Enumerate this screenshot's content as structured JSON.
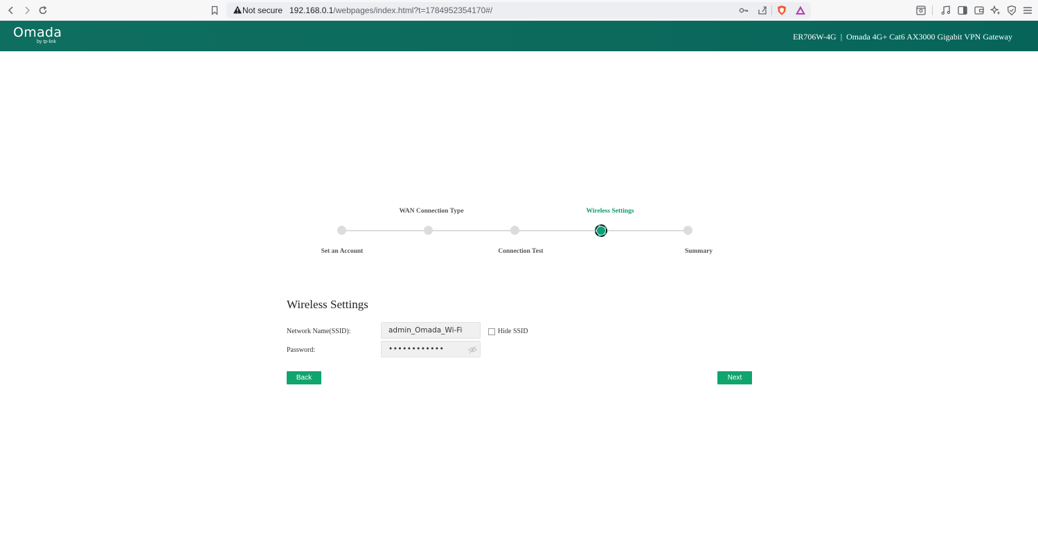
{
  "browser": {
    "not_secure_label": "Not secure",
    "url_host": "192.168.0.1",
    "url_path": "/webpages/index.html?t=1784952354170#/"
  },
  "header": {
    "logo_main": "Omada",
    "logo_sub": "by tp-link",
    "device_model": "ER706W-4G",
    "separator": "|",
    "device_name": "Omada 4G+ Cat6 AX3000 Gigabit VPN Gateway"
  },
  "stepper": {
    "steps": [
      {
        "label": "Set an Account",
        "position": "bottom"
      },
      {
        "label": "WAN Connection Type",
        "position": "top"
      },
      {
        "label": "Connection Test",
        "position": "bottom"
      },
      {
        "label": "Wireless Settings",
        "position": "top"
      },
      {
        "label": "Summary",
        "position": "bottom"
      }
    ],
    "active_index": 3
  },
  "form": {
    "title": "Wireless Settings",
    "ssid_label": "Network Name(SSID):",
    "ssid_value": "admin_Omada_Wi-Fi",
    "hide_ssid_label": "Hide SSID",
    "hide_ssid_checked": false,
    "password_label": "Password:",
    "password_value": "••••••••••••",
    "back_label": "Back",
    "next_label": "Next"
  },
  "colors": {
    "header_bg": "#0b6a5c",
    "accent": "#10a46f",
    "active_step": "#0aa17a"
  }
}
